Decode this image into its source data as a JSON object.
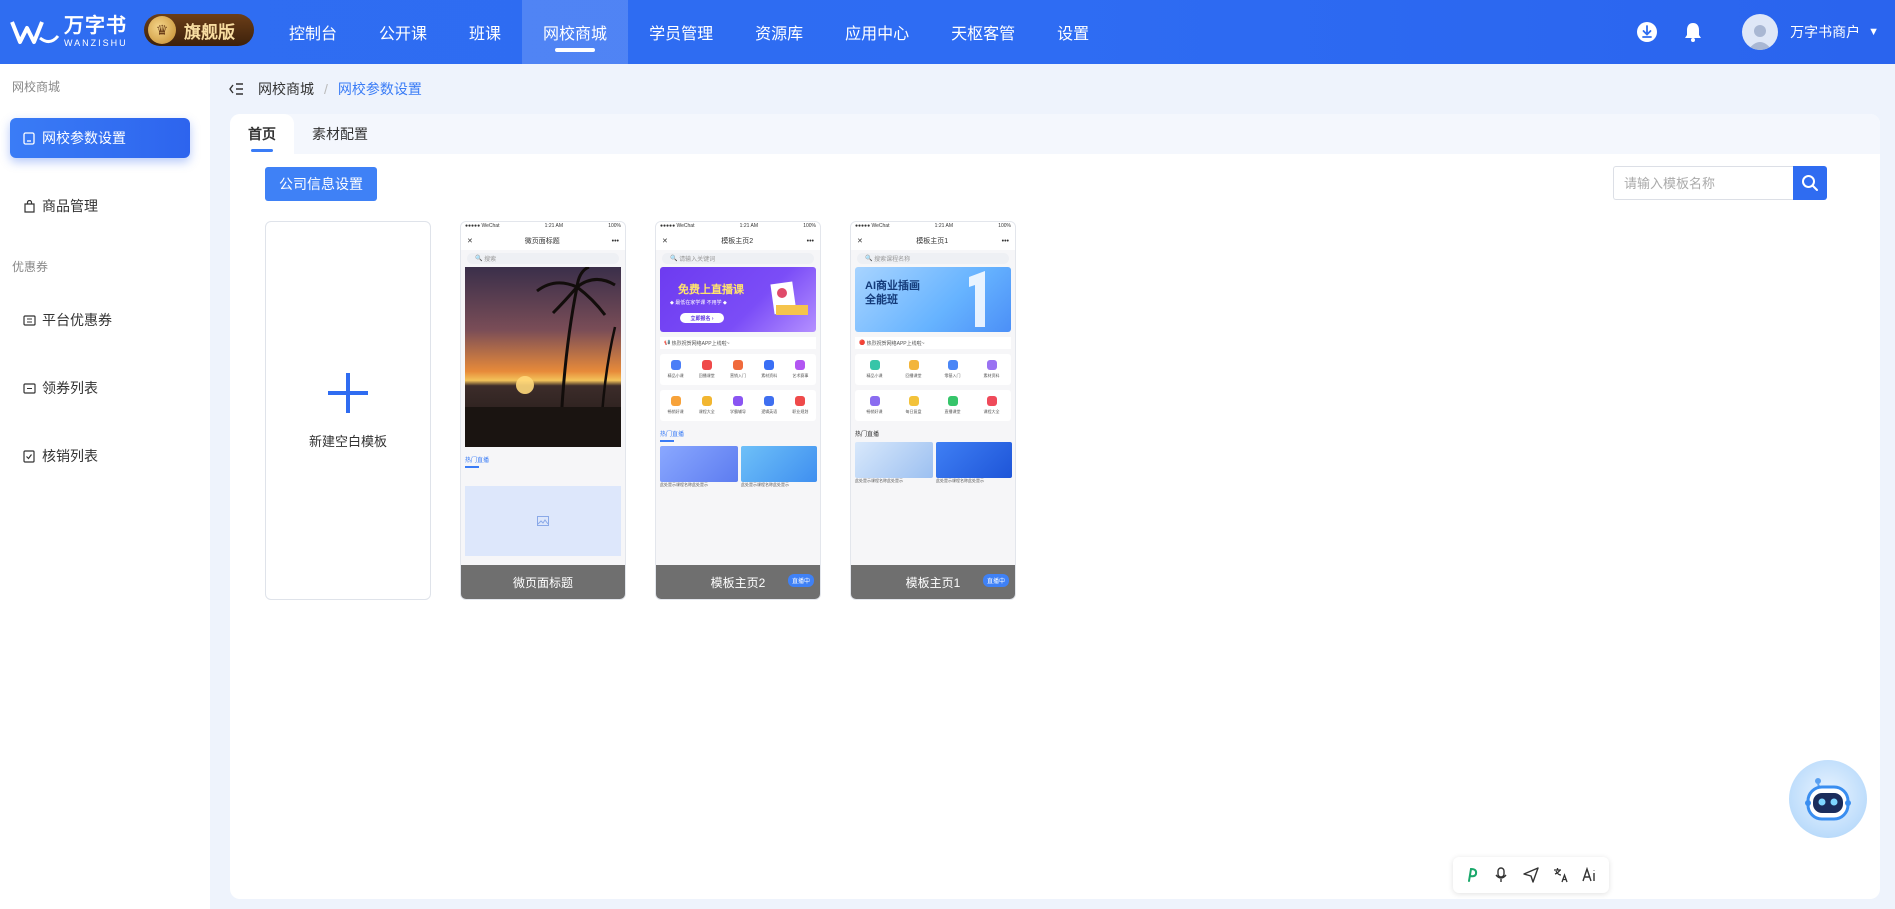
{
  "brand": {
    "name_cn": "万字书",
    "name_en": "WANZISHU",
    "edition": "旗舰版"
  },
  "nav": {
    "items": [
      {
        "label": "控制台"
      },
      {
        "label": "公开课"
      },
      {
        "label": "班课"
      },
      {
        "label": "网校商城"
      },
      {
        "label": "学员管理"
      },
      {
        "label": "资源库"
      },
      {
        "label": "应用中心"
      },
      {
        "label": "天枢客管"
      },
      {
        "label": "设置"
      }
    ],
    "active_index": 3,
    "user_name": "万字书商户"
  },
  "sidebar": {
    "group1": "网校商城",
    "group2": "优惠券",
    "items": [
      {
        "label": "网校参数设置",
        "icon": "document-icon"
      },
      {
        "label": "商品管理",
        "icon": "bag-icon"
      },
      {
        "label": "平台优惠券",
        "icon": "coupon-icon"
      },
      {
        "label": "领券列表",
        "icon": "ticket-icon"
      },
      {
        "label": "核销列表",
        "icon": "check-doc-icon"
      }
    ]
  },
  "breadcrumb": {
    "items": [
      "网校商城",
      "网校参数设置"
    ]
  },
  "tabs": [
    {
      "label": "首页"
    },
    {
      "label": "素材配置"
    }
  ],
  "toolbar": {
    "company_button": "公司信息设置"
  },
  "search": {
    "placeholder": "请输入模板名称"
  },
  "new_template": {
    "label": "新建空白模板"
  },
  "templates": [
    {
      "name": "微页面标题",
      "phone_carrier": "●●●●● WeChat",
      "phone_time": "1:21 AM",
      "phone_battery": "100%",
      "header": "微页面标题",
      "search": "搜索",
      "section": "热门直播"
    },
    {
      "name": "模板主页2",
      "phone_carrier": "●●●●● WeChat",
      "phone_time": "1:21 AM",
      "phone_battery": "100%",
      "header": "模板主页2",
      "search": "请输入关键词",
      "banner_title": "免费上直播课",
      "banner_sub": "◆ 最低在家学课 不用学 ◆",
      "banner_btn": "立即报名 ›",
      "notice": "热烈祝贺网络APP上线啦~",
      "icons_row1": [
        "精品小课",
        "回播课堂",
        "营销入门",
        "素材资料",
        "艺术赛事"
      ],
      "icons_row2": [
        "畅销好课",
        "课程大全",
        "学霸辅导",
        "逻辑英语",
        "职业规划"
      ],
      "section": "热门直播",
      "card_caption_1": "此处是示课程名称此处是示",
      "card_caption_2": "此处是示课程名称此处是示",
      "overlay_tag": "直播中"
    },
    {
      "name": "模板主页1",
      "phone_carrier": "●●●●● WeChat",
      "phone_time": "1:21 AM",
      "phone_battery": "100%",
      "header": "模板主页1",
      "search": "搜索课程名称",
      "banner_title": "AI商业插画\n全能班",
      "notice": "热烈祝贺网络APP上线啦~",
      "icons_row1": [
        "精品小课",
        "回播课堂",
        "零基入门",
        "素材资料"
      ],
      "icons_row2": [
        "畅销好课",
        "每日复盘",
        "直播课堂",
        "课程大全"
      ],
      "section": "热门直播",
      "card_caption_1": "此处是示课程名称此处是示",
      "card_caption_2": "此处是示课程名称此处是示",
      "overlay_tag": "直播中"
    }
  ],
  "colors": {
    "primary": "#2f6df1",
    "accent": "#3f81f6"
  }
}
